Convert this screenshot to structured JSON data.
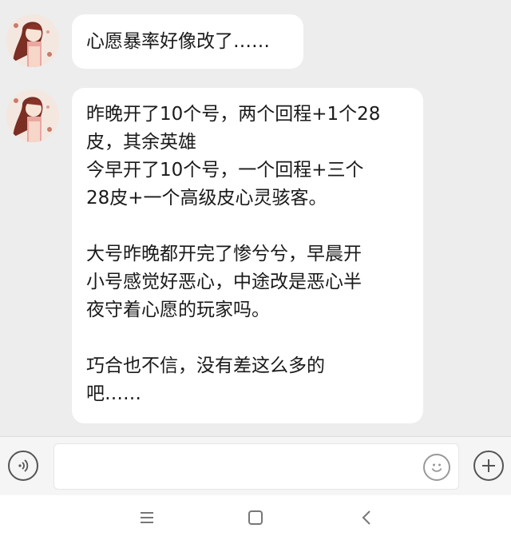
{
  "messages": [
    {
      "sender": "avatar",
      "lines": [
        "心愿暴率好像改了……"
      ]
    },
    {
      "sender": "avatar",
      "paragraphs": [
        [
          "昨晚开了10个号，两个回程+1个28",
          "皮，其余英雄",
          "今早开了10个号，一个回程+三个",
          "28皮+一个高级皮心灵骇客。"
        ],
        [
          "大号昨晚都开完了惨兮兮，早晨开",
          "小号感觉好恶心，中途改是恶心半",
          "夜守着心愿的玩家吗。"
        ],
        [
          "巧合也不信，没有差这么多的",
          "吧……"
        ]
      ]
    }
  ],
  "input_bar": {
    "value": "",
    "voice_icon": "voice-icon",
    "emoji_icon": "emoji-icon",
    "plus_icon": "plus-icon"
  },
  "nav_bar": {
    "menu_icon": "menu-icon",
    "home_icon": "home-square-icon",
    "back_icon": "back-chevron-icon"
  },
  "colors": {
    "background": "#ededed",
    "bubble": "#ffffff",
    "text": "#1a1a1a",
    "icon": "#555555"
  }
}
